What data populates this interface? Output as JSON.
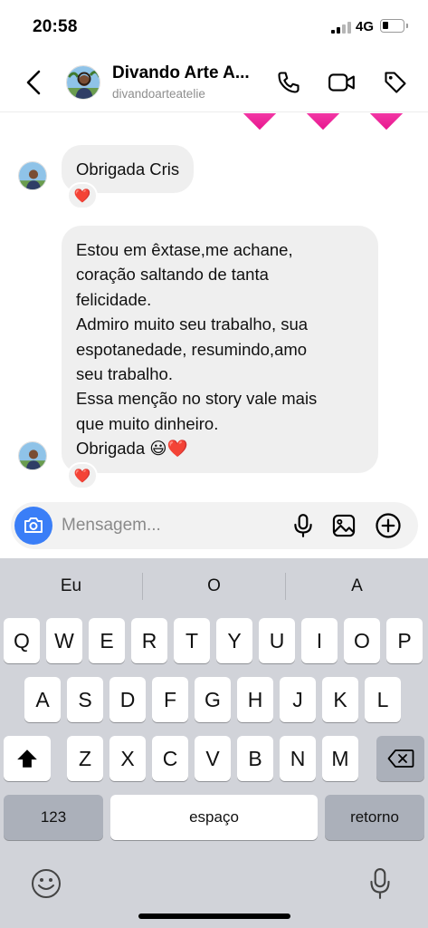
{
  "status_bar": {
    "time": "20:58",
    "network": "4G",
    "icons": [
      "signal-icon",
      "battery-icon"
    ]
  },
  "header": {
    "contact_name": "Divando Arte A...",
    "username": "divandoarteatelie",
    "icons": [
      "back-arrow-icon",
      "phone-icon",
      "video-camera-icon",
      "tag-icon"
    ]
  },
  "messages": [
    {
      "lines": [
        "Obrigada Cris"
      ],
      "reaction": "❤️"
    },
    {
      "lines": [
        "Estou em êxtase,me achane,",
        "coração saltando de tanta",
        "felicidade.",
        "Admiro muito seu trabalho, sua",
        "espotanedade, resumindo,amo",
        "seu trabalho.",
        "Essa menção no story  vale mais",
        "que muito dinheiro.",
        "Obrigada 😃❤️"
      ],
      "reaction": "❤️"
    }
  ],
  "composer": {
    "placeholder": "Mensagem...",
    "icons": [
      "camera-icon",
      "microphone-icon",
      "image-icon",
      "plus-circle-icon"
    ],
    "camera_color": "#3a7ef7"
  },
  "keyboard": {
    "suggestions": [
      "Eu",
      "O",
      "A"
    ],
    "row1": [
      "Q",
      "W",
      "E",
      "R",
      "T",
      "Y",
      "U",
      "I",
      "O",
      "P"
    ],
    "row2": [
      "A",
      "S",
      "D",
      "F",
      "G",
      "H",
      "J",
      "K",
      "L"
    ],
    "row3": [
      "Z",
      "X",
      "C",
      "V",
      "B",
      "N",
      "M"
    ],
    "numbers_label": "123",
    "space_label": "espaço",
    "return_label": "retorno",
    "icons": [
      "shift-icon",
      "backspace-icon",
      "emoji-icon",
      "dictation-mic-icon"
    ]
  }
}
